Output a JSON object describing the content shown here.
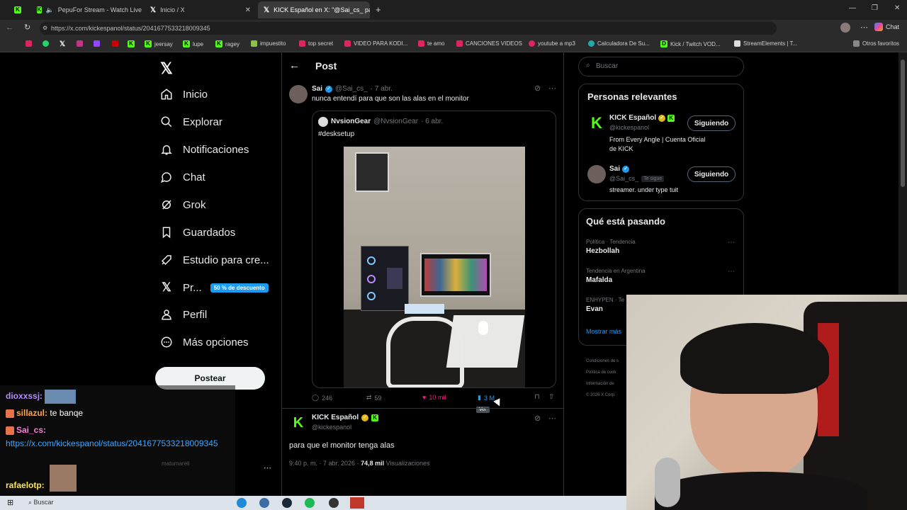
{
  "browser": {
    "tabs": [
      {
        "label": "",
        "icon": "kick"
      },
      {
        "label": "PepuFor Stream - Watch Live",
        "icon": "kick"
      },
      {
        "label": "Inicio / X",
        "icon": "x"
      },
      {
        "label": "KICK Español en X: \"@Sai_cs_ para",
        "icon": "x",
        "active": true
      }
    ],
    "url": "https://x.com/kickespanol/status/2041677533218009345",
    "profile_label": "Chat",
    "bookmarks": [
      "jeersay",
      "lupe",
      "ragey",
      "impuestito",
      "top secret",
      "VIDEO PARA KODI...",
      "te amo",
      "CANCIONES VIDEOS",
      "youtube a mp3",
      "Calculadora De Su...",
      "Kick / Twitch VOD...",
      "StreamElements | T...",
      "Otros favoritos"
    ]
  },
  "nav": {
    "items": [
      "Inicio",
      "Explorar",
      "Notificaciones",
      "Chat",
      "Grok",
      "Guardados",
      "Estudio para cre...",
      "Pr...",
      "Perfil",
      "Más opciones"
    ],
    "premium_badge": "50 % de descuento",
    "post_button": "Postear"
  },
  "header": {
    "title": "Post"
  },
  "tweet": {
    "name": "Sai",
    "handle": "@Sai_cs_",
    "time": "· 7 abr.",
    "text": "nunca entendí para que son las alas en el monitor",
    "quote": {
      "name": "NvsionGear",
      "handle": "@NvsionGear",
      "time": "· 6 abr.",
      "text": "#desksetup"
    },
    "stats": {
      "replies": "246",
      "reposts": "59",
      "likes": "10 mil",
      "views": "3 M",
      "tooltip": "Ver"
    }
  },
  "reply": {
    "name": "KICK Español",
    "handle": "@kickespanol",
    "text": "para que el monitor tenga alas",
    "meta_time": "9:40 p. m. · 7 abr. 2026 · ",
    "meta_views": "74,8 mil",
    "meta_views_label": " Visualizaciones"
  },
  "search": {
    "placeholder": "Buscar"
  },
  "relevant": {
    "title": "Personas relevantes",
    "people": [
      {
        "name": "KICK Español",
        "handle": "@kickespanol",
        "bio": "From Every Angle | Cuenta Oficial de KICK",
        "button": "Siguiendo"
      },
      {
        "name": "Sai",
        "handle": "@Sai_cs_",
        "follows_you": "Te sigue",
        "bio": "streamer. under type tuit",
        "button": "Siguiendo"
      }
    ]
  },
  "trends": {
    "title": "Qué está pasando",
    "items": [
      {
        "context": "Política · Tendencia",
        "name": "Hezbollah"
      },
      {
        "context": "Tendencia en Argentina",
        "name": "Mafalda"
      },
      {
        "context": "ENHYPEN · Te",
        "name": "Evan"
      }
    ],
    "show_more": "Mostrar más"
  },
  "footer": {
    "lines": [
      "Condiciones de s",
      "Política de cook",
      "Información de",
      "© 2026 X Corp."
    ]
  },
  "chat": {
    "messages": [
      {
        "user": "dioxxssj:",
        "text": ""
      },
      {
        "user": "sillazul:",
        "text": "te banqe"
      },
      {
        "user": "Sai_cs:",
        "text": "https://x.com/kickespanol/status/2041677533218009345"
      },
      {
        "user": "rafaelotp:",
        "text": ""
      }
    ],
    "faded_user": "matumareli"
  },
  "taskbar": {
    "search": "Buscar"
  },
  "colors": {
    "accent": "#1d9bf0",
    "kick": "#53fc18",
    "like": "#f91880",
    "gold": "#e2b719"
  }
}
